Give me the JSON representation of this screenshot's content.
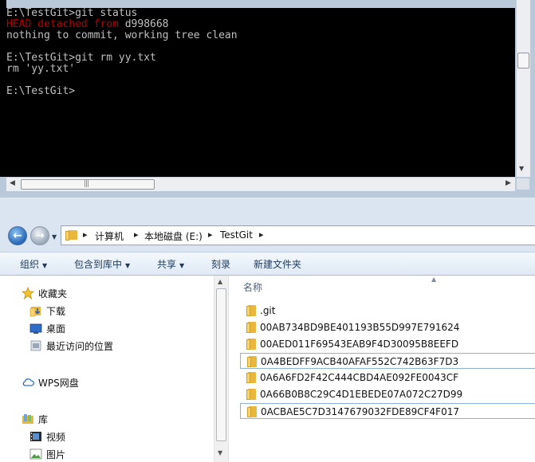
{
  "console": {
    "lines": [
      {
        "segments": [
          {
            "text": "E:\\TestGit>git status",
            "color": "#c0c0c0"
          }
        ]
      },
      {
        "segments": [
          {
            "text": "HEAD detached from ",
            "color": "#b00000"
          },
          {
            "text": "d998668",
            "color": "#c0c0c0"
          }
        ]
      },
      {
        "segments": [
          {
            "text": "nothing to commit, working tree clean",
            "color": "#c0c0c0"
          }
        ]
      },
      {
        "segments": [
          {
            "text": "",
            "color": "#c0c0c0"
          }
        ]
      },
      {
        "segments": [
          {
            "text": "E:\\TestGit>git rm yy.txt",
            "color": "#c0c0c0"
          }
        ]
      },
      {
        "segments": [
          {
            "text": "rm 'yy.txt'",
            "color": "#c0c0c0"
          }
        ]
      },
      {
        "segments": [
          {
            "text": "",
            "color": "#c0c0c0"
          }
        ]
      },
      {
        "segments": [
          {
            "text": "E:\\TestGit>",
            "color": "#c0c0c0"
          }
        ]
      }
    ]
  },
  "explorer": {
    "breadcrumb": [
      "计算机",
      "本地磁盘 (E:)",
      "TestGit"
    ],
    "toolbar": {
      "organize": "组织",
      "include_in_library": "包含到库中",
      "share": "共享",
      "burn": "刻录",
      "new_folder": "新建文件夹"
    },
    "nav": {
      "favorites": "收藏夹",
      "downloads": "下载",
      "desktop": "桌面",
      "recent_places": "最近访问的位置",
      "wps_cloud": "WPS网盘",
      "libraries": "库",
      "videos": "视频",
      "pictures": "图片"
    },
    "column_name": "名称",
    "files": [
      ".git",
      "00AB734BD9BE401193B55D997E791624",
      "00AED011F69543EAB9F4D30095B8EEFD",
      "0A4BEDFF9ACB40AFAF552C742B63F7D3",
      "0A6A6FD2F42C444CBD4AE092FE0043CF",
      "0A66B0B8C29C4D1EBEDE07A072C27D99",
      "0ACBAE5C7D3147679032FDE89CF4F017"
    ],
    "focused_files": [
      3,
      6
    ]
  },
  "colors": {
    "console_bg": "#000000",
    "console_text": "#c0c0c0",
    "console_error": "#b00000",
    "folder": "#e8b73c"
  }
}
